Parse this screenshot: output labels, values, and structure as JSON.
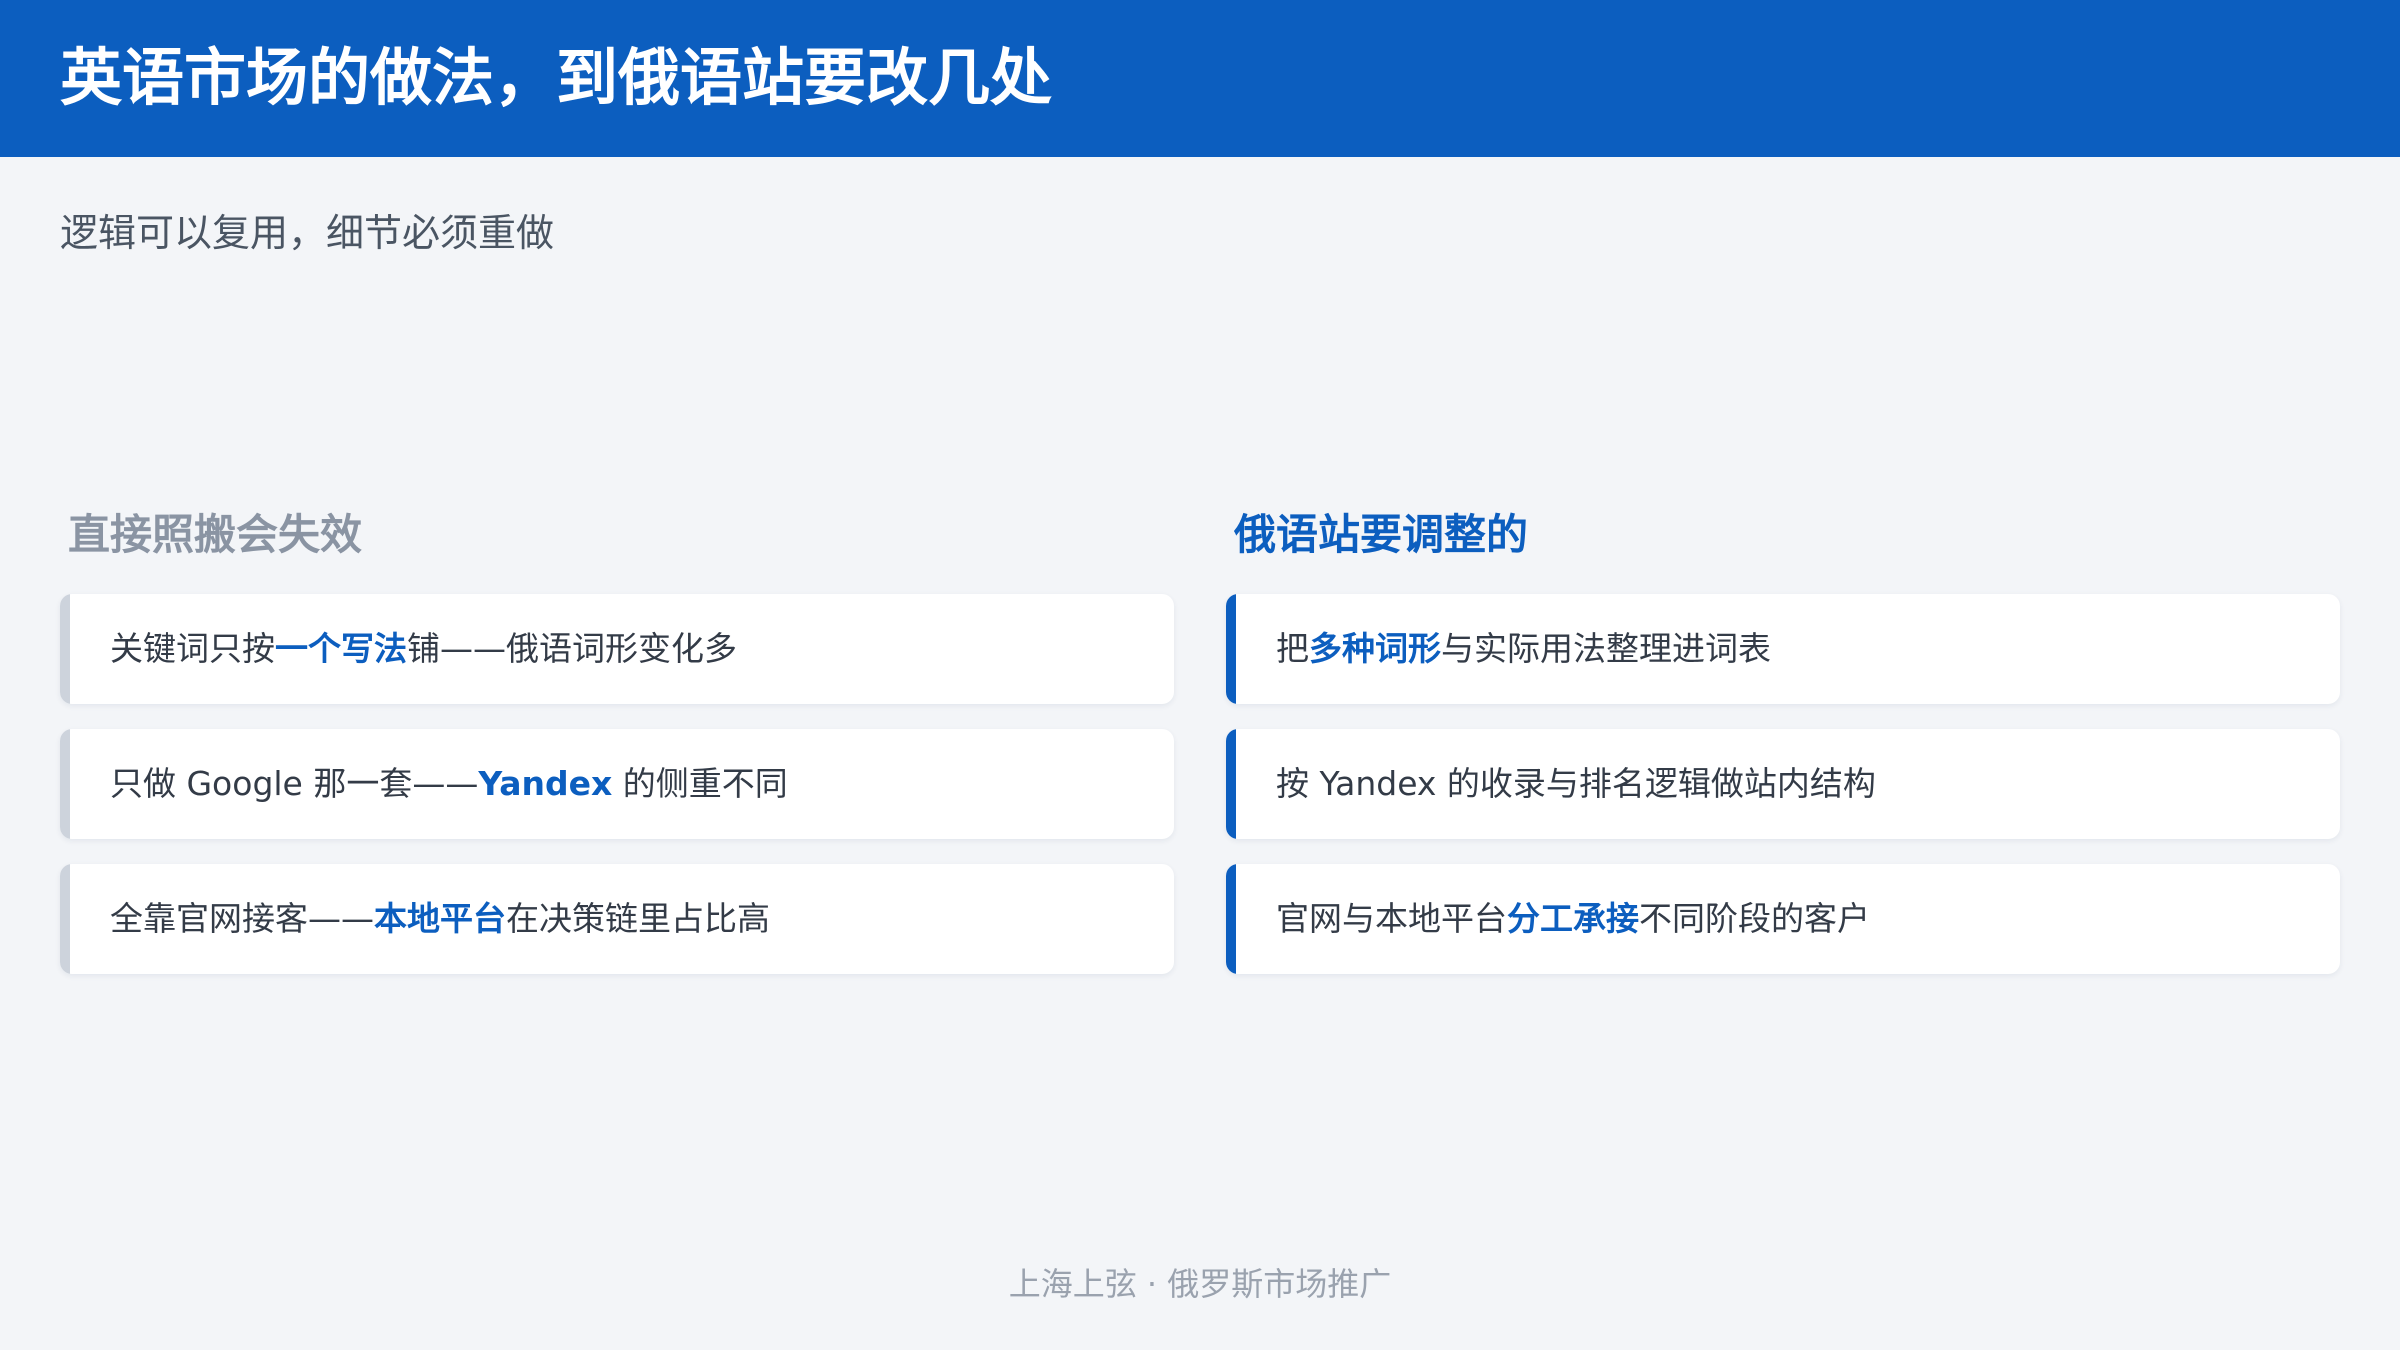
{
  "slide": {
    "title": "英语市场的做法，到俄语站要改几处",
    "subtitle": "逻辑可以复用，细节必须重做",
    "footer": "上海上弦 · 俄罗斯市场推广"
  },
  "left_column": {
    "heading": "直接照搬会失效",
    "items": [
      {
        "pre": "关键词只按",
        "highlight": "一个写法",
        "post": "铺——俄语词形变化多"
      },
      {
        "pre": "只做 Google 那一套——",
        "highlight": "Yandex",
        "post": " 的侧重不同"
      },
      {
        "pre": "全靠官网接客——",
        "highlight": "本地平台",
        "post": "在决策链里占比高"
      }
    ]
  },
  "right_column": {
    "heading": "俄语站要调整的",
    "items": [
      {
        "pre": "把",
        "highlight": "多种词形",
        "post": "与实际用法整理进词表"
      },
      {
        "pre": "按 Yandex 的收录与排名逻辑做站内结构",
        "highlight": "",
        "post": ""
      },
      {
        "pre": "官网与本地平台",
        "highlight": "分工承接",
        "post": "不同阶段的客户"
      }
    ]
  },
  "colors": {
    "header_bg": "#0c5ebf",
    "accent": "#0c5ebf",
    "muted_heading": "#8a94a3",
    "left_bar": "#cdd3dc",
    "page_bg": "#f3f5f8"
  }
}
